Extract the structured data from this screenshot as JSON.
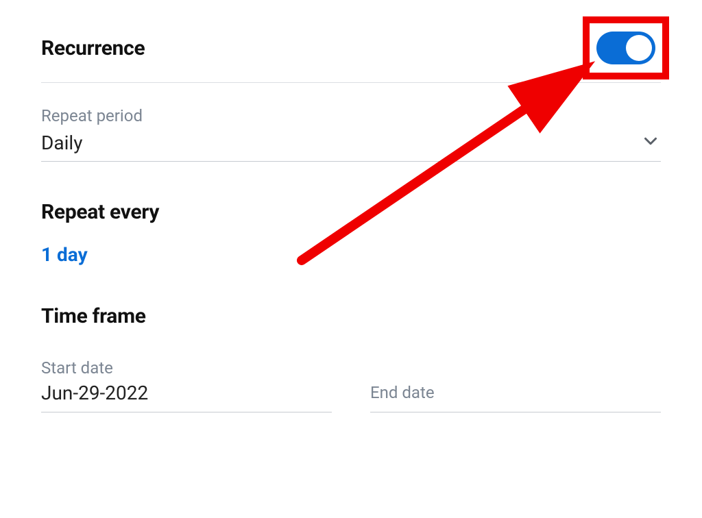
{
  "recurrence": {
    "title": "Recurrence",
    "toggle_on": true
  },
  "repeat_period": {
    "label": "Repeat period",
    "value": "Daily"
  },
  "repeat_every": {
    "title": "Repeat every",
    "interval": "1 day"
  },
  "time_frame": {
    "title": "Time frame",
    "start_date": {
      "label": "Start date",
      "value": "Jun-29-2022"
    },
    "end_date": {
      "label": "End date",
      "value": ""
    }
  }
}
